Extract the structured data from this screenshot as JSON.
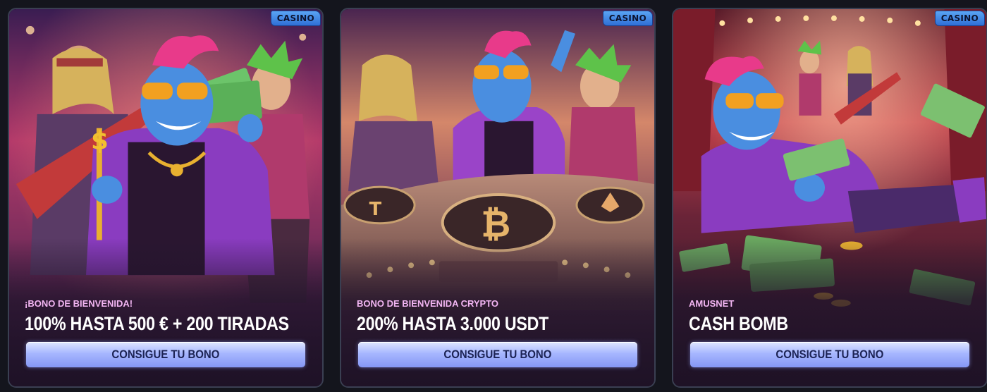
{
  "cards": [
    {
      "badge": "CASINO",
      "kicker": "¡BONO DE BIENVENIDA!",
      "headline": "100% HASTA 500 € + 200 TIRADAS",
      "cta": "CONSIGUE TU BONO"
    },
    {
      "badge": "CASINO",
      "kicker": "BONO DE BIENVENIDA CRYPTO",
      "headline": "200% HASTA 3.000 USDT",
      "cta": "CONSIGUE TU BONO"
    },
    {
      "badge": "CASINO",
      "kicker": "AMUSNET",
      "headline": "CASH BOMB",
      "cta": "CONSIGUE TU BONO"
    }
  ],
  "colors": {
    "background": "#14151d",
    "badge": "#3f86e6",
    "kicker": "#f3b6f3",
    "cta": "#a7b7ff"
  }
}
